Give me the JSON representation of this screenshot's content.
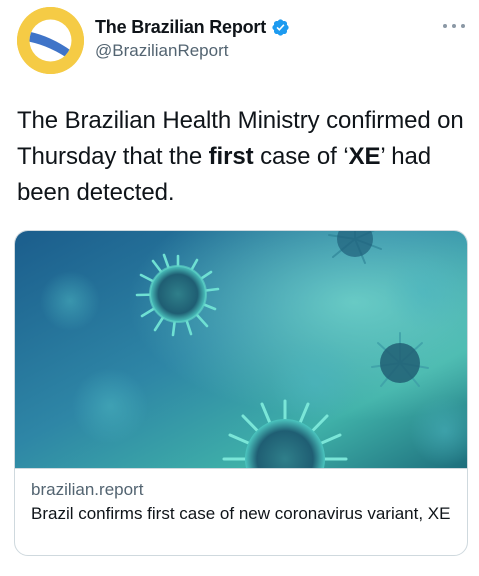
{
  "author": {
    "display_name": "The Brazilian Report",
    "handle": "@BrazilianReport",
    "verified": true,
    "avatar_icon": "brazilian-report-logo-icon",
    "avatar_colors": {
      "background": "#f5cb45",
      "band": "#3f74c8",
      "circle": "#ffffff"
    }
  },
  "tweet": {
    "text_part1": "The Brazilian Health Ministry confirmed on Thursday that the ",
    "text_bold1": "first",
    "text_part2": " case of ‘",
    "text_bold2": "XE",
    "text_part3": "’ had been detected."
  },
  "link_card": {
    "image_icon": "coronavirus-image",
    "domain": "brazilian.report",
    "title": "Brazil confirms first case of new coronavirus variant, XE"
  },
  "colors": {
    "verified_badge": "#1d9bf0",
    "secondary_text": "#536471",
    "card_border": "#cfd9de"
  }
}
